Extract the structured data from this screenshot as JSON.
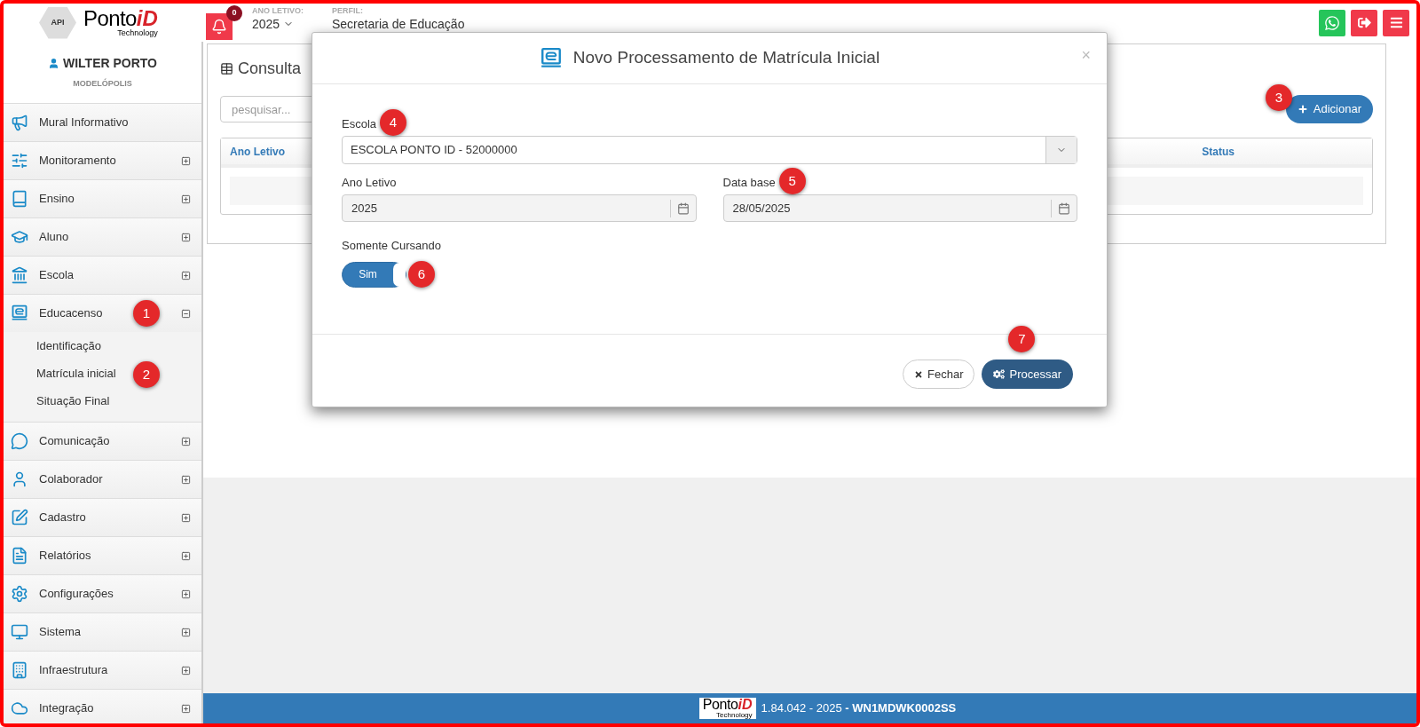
{
  "header": {
    "logo": {
      "badge": "API",
      "name": "Ponto",
      "accent": "iD",
      "tagline": "Technology"
    },
    "notifications": {
      "count": "0"
    },
    "year": {
      "label": "ANO LETIVO:",
      "value": "2025"
    },
    "profile": {
      "label": "PERFIL:",
      "value": "Secretaria de Educação"
    }
  },
  "user": {
    "name": "WILTER PORTO",
    "city": "MODELÓPOLIS"
  },
  "sidebar": {
    "items": [
      {
        "kind": "link",
        "label": "Mural Informativo"
      },
      {
        "kind": "group",
        "label": "Monitoramento",
        "expanded": false
      },
      {
        "kind": "group",
        "label": "Ensino",
        "expanded": false
      },
      {
        "kind": "group",
        "label": "Aluno",
        "expanded": false
      },
      {
        "kind": "group",
        "label": "Escola",
        "expanded": false
      },
      {
        "kind": "group",
        "label": "Educacenso",
        "expanded": true,
        "callout": "1",
        "children": [
          {
            "label": "Identificação"
          },
          {
            "label": "Matrícula inicial",
            "callout": "2"
          },
          {
            "label": "Situação Final"
          }
        ]
      },
      {
        "kind": "group",
        "label": "Comunicação",
        "expanded": false
      },
      {
        "kind": "group",
        "label": "Colaborador",
        "expanded": false
      },
      {
        "kind": "group",
        "label": "Cadastro",
        "expanded": false
      },
      {
        "kind": "group",
        "label": "Relatórios",
        "expanded": false
      },
      {
        "kind": "group",
        "label": "Configurações",
        "expanded": false
      },
      {
        "kind": "group",
        "label": "Sistema",
        "expanded": false
      },
      {
        "kind": "group",
        "label": "Infraestrutura",
        "expanded": false
      },
      {
        "kind": "group",
        "label": "Integração",
        "expanded": false
      }
    ]
  },
  "page": {
    "title": "Consulta",
    "search": {
      "placeholder": "pesquisar..."
    },
    "add_button": {
      "label": "Adicionar",
      "callout": "3"
    },
    "table": {
      "columns": [
        "Ano Letivo",
        "Status"
      ]
    }
  },
  "modal": {
    "title": "Novo Processamento de Matrícula Inicial",
    "close": "×",
    "fields": [
      {
        "kind": "select",
        "label": "Escola",
        "value": "ESCOLA PONTO ID - 52000000",
        "callout": "4"
      },
      {
        "kind": "date",
        "label": "Ano Letivo",
        "value": "2025"
      },
      {
        "kind": "date",
        "label": "Data base",
        "value": "28/05/2025",
        "callout": "5"
      },
      {
        "kind": "switch",
        "label": "Somente Cursando",
        "on": true,
        "text": "Sim",
        "callout": "6"
      }
    ],
    "buttons": [
      {
        "kind": "secondary",
        "label": "Fechar"
      },
      {
        "kind": "primary",
        "label": "Processar",
        "callout": "7"
      }
    ]
  },
  "footer": {
    "logo": {
      "name": "Ponto",
      "accent": "iD",
      "tagline": "Technology"
    },
    "text": "1.84.042 - 2025 **- WN1MDWK0002SS**"
  }
}
